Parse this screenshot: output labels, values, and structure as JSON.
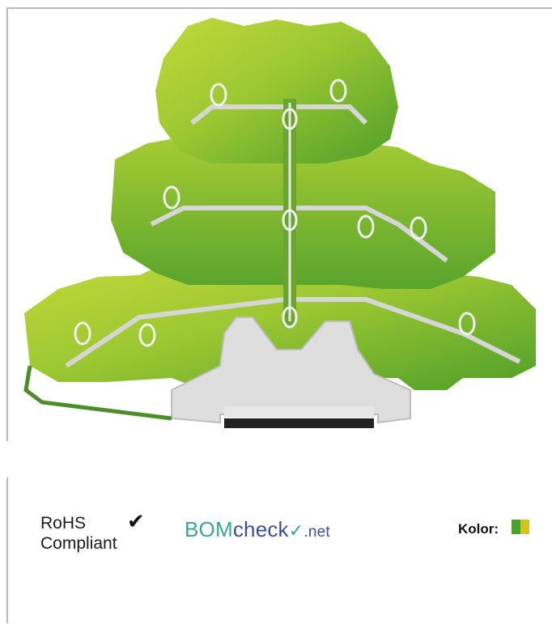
{
  "product": {
    "image_name": "three-tier-ground-terminal-block",
    "body_color_primary": "#a8cc2c",
    "body_color_secondary": "#5fae2e",
    "mount_color": "#dcdcdc"
  },
  "rohs": {
    "line1": "RoHS",
    "line2": "Compliant",
    "check_icon": "checkmark-icon"
  },
  "bomcheck": {
    "part1": "BOM",
    "part2": "check",
    "tick": "✓",
    "part3": ".net"
  },
  "color_info": {
    "label": "Kolor:",
    "swatch_colors": [
      "#4ca02c",
      "#d7c41a"
    ]
  }
}
